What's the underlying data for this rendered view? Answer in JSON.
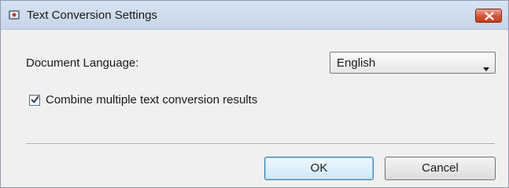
{
  "window": {
    "title": "Text Conversion Settings"
  },
  "document_language": {
    "label": "Document Language:",
    "selected": "English"
  },
  "combine_option": {
    "label": "Combine multiple text conversion results",
    "checked": true
  },
  "buttons": {
    "ok": "OK",
    "cancel": "Cancel"
  },
  "colors": {
    "close_button": "#d3553b",
    "ok_button_border": "#3c7fb1",
    "dialog_background": "#f0f0f0"
  },
  "icons": {
    "app": "app-icon",
    "close": "close-icon",
    "dropdown": "chevron-down-icon",
    "check": "checkmark-icon"
  }
}
